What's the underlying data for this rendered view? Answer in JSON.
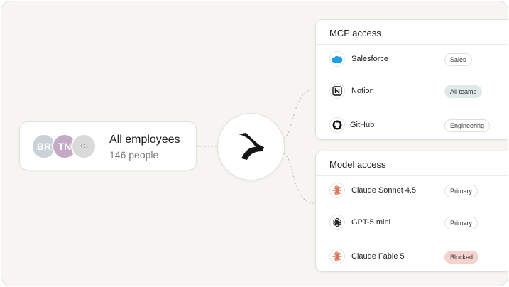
{
  "group": {
    "avatars": [
      {
        "initials": "BR",
        "color": "#c9d2d9"
      },
      {
        "initials": "TN",
        "color": "#c4a9c6"
      },
      {
        "initials": "+3",
        "color": "#dadada"
      }
    ],
    "title": "All employees",
    "subtitle": "146 people"
  },
  "center": {
    "icon": "brand-logo-icon"
  },
  "mcp": {
    "title": "MCP access",
    "items": [
      {
        "name": "Salesforce",
        "icon": "salesforce-icon",
        "badge": "Sales",
        "badge_style": "outline"
      },
      {
        "name": "Notion",
        "icon": "notion-icon",
        "badge": "All teams",
        "badge_style": "teal"
      },
      {
        "name": "GitHub",
        "icon": "github-icon",
        "badge": "Engineering",
        "badge_style": "outline"
      }
    ]
  },
  "models": {
    "title": "Model access",
    "items": [
      {
        "name": "Claude Sonnet 4.5",
        "icon": "claude-icon",
        "badge": "Primary",
        "badge_style": "outline"
      },
      {
        "name": "GPT-5 mini",
        "icon": "openai-icon",
        "badge": "Primary",
        "badge_style": "outline"
      },
      {
        "name": "Claude Fable 5",
        "icon": "claude-icon",
        "badge": "Blocked",
        "badge_style": "red"
      }
    ]
  },
  "colors": {
    "background": "#f6f5f1",
    "claude_accent": "#d97757",
    "salesforce_blue": "#1ea1e0",
    "blocked_badge": "#f5d2cc",
    "teal_badge": "#dfe9e8"
  }
}
